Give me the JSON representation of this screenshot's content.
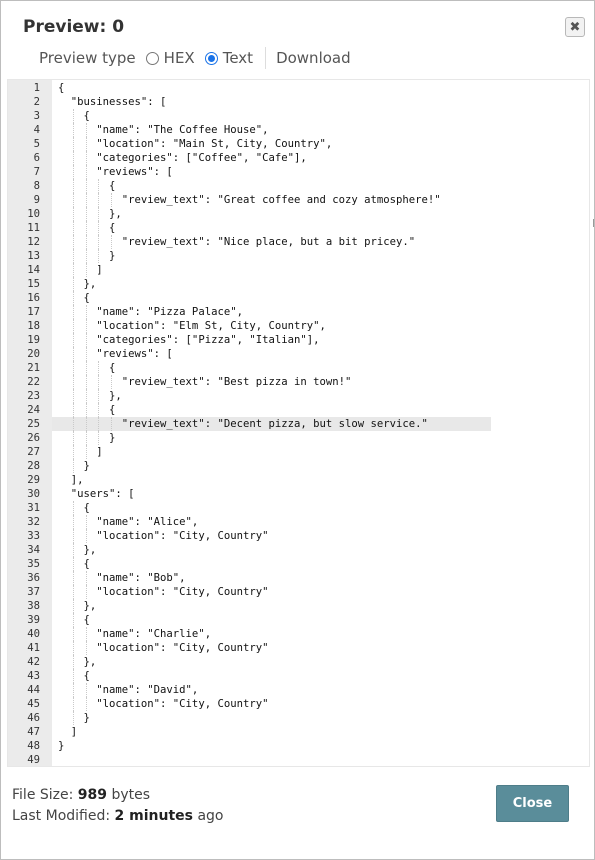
{
  "dialog": {
    "title": "Preview: 0",
    "close_icon": "close-icon"
  },
  "toolbar": {
    "preview_type_label": "Preview type",
    "options": [
      {
        "label": "HEX",
        "selected": false
      },
      {
        "label": "Text",
        "selected": true
      }
    ],
    "download_label": "Download"
  },
  "editor": {
    "active_line": 25,
    "lines": [
      "{",
      "  \"businesses\": [",
      "    {",
      "      \"name\": \"The Coffee House\",",
      "      \"location\": \"Main St, City, Country\",",
      "      \"categories\": [\"Coffee\", \"Cafe\"],",
      "      \"reviews\": [",
      "        {",
      "          \"review_text\": \"Great coffee and cozy atmosphere!\"",
      "        },",
      "        {",
      "          \"review_text\": \"Nice place, but a bit pricey.\"",
      "        }",
      "      ]",
      "    },",
      "    {",
      "      \"name\": \"Pizza Palace\",",
      "      \"location\": \"Elm St, City, Country\",",
      "      \"categories\": [\"Pizza\", \"Italian\"],",
      "      \"reviews\": [",
      "        {",
      "          \"review_text\": \"Best pizza in town!\"",
      "        },",
      "        {",
      "          \"review_text\": \"Decent pizza, but slow service.\"",
      "        }",
      "      ]",
      "    }",
      "  ],",
      "  \"users\": [",
      "    {",
      "      \"name\": \"Alice\",",
      "      \"location\": \"City, Country\"",
      "    },",
      "    {",
      "      \"name\": \"Bob\",",
      "      \"location\": \"City, Country\"",
      "    },",
      "    {",
      "      \"name\": \"Charlie\",",
      "      \"location\": \"City, Country\"",
      "    },",
      "    {",
      "      \"name\": \"David\",",
      "      \"location\": \"City, Country\"",
      "    }",
      "  ]",
      "}",
      ""
    ]
  },
  "footer": {
    "file_size_label": "File Size:",
    "file_size_value": "989",
    "file_size_unit": "bytes",
    "modified_label": "Last Modified:",
    "modified_value": "2 minutes",
    "modified_suffix": "ago"
  },
  "close_button": {
    "label": "Close"
  },
  "colors": {
    "accent": "#1a73e8",
    "close_button_bg": "#5a8d9a",
    "gutter_bg": "#ebebeb",
    "active_line_bg": "#e8e8e8"
  }
}
